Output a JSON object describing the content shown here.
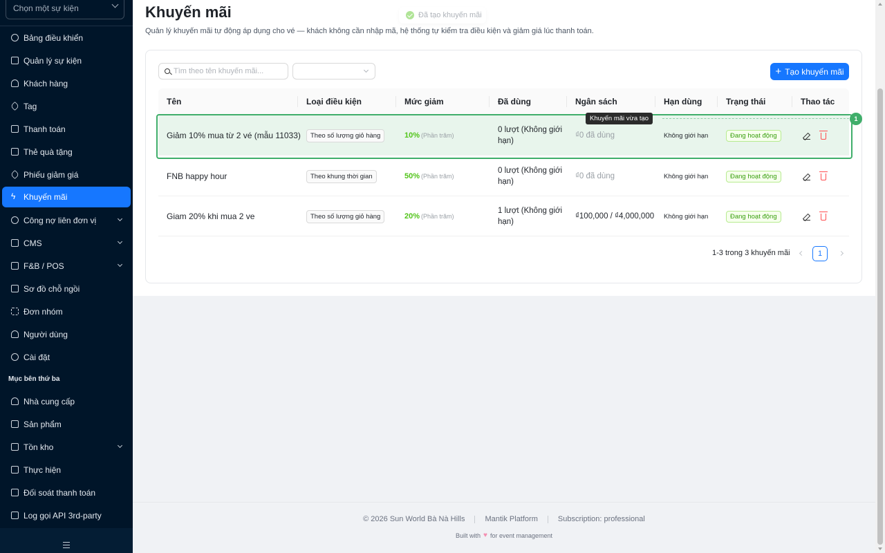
{
  "sidebar": {
    "event_select_placeholder": "Chọn một sự kiện",
    "items": [
      {
        "label": "Bảng điều khiển"
      },
      {
        "label": "Quản lý sự kiện"
      },
      {
        "label": "Khách hàng"
      },
      {
        "label": "Tag"
      },
      {
        "label": "Thanh toán"
      },
      {
        "label": "Thẻ quà tặng"
      },
      {
        "label": "Phiếu giảm giá"
      },
      {
        "label": "Khuyến mãi"
      },
      {
        "label": "Công nợ liên đơn vị"
      },
      {
        "label": "CMS"
      },
      {
        "label": "F&B / POS"
      },
      {
        "label": "Sơ đồ chỗ ngồi"
      },
      {
        "label": "Đơn nhóm"
      },
      {
        "label": "Người dùng"
      },
      {
        "label": "Cài đặt"
      }
    ],
    "group_title": "Mục bên thứ ba",
    "group_items": [
      {
        "label": "Nhà cung cấp"
      },
      {
        "label": "Sản phẩm"
      },
      {
        "label": "Tồn kho"
      },
      {
        "label": "Thực hiện"
      },
      {
        "label": "Đối soát thanh toán"
      },
      {
        "label": "Log gọi API 3rd-party"
      }
    ]
  },
  "page": {
    "title": "Khuyến mãi",
    "description": "Quản lý khuyến mãi tự động áp dụng cho vé — khách không cần nhập mã, hệ thống tự kiểm tra điều kiện và giảm giá lúc thanh toán.",
    "toast": "Đã tạo khuyến mãi"
  },
  "toolbar": {
    "search_placeholder": "Tìm theo tên khuyến mãi...",
    "add_label": "Tạo khuyến mãi"
  },
  "table": {
    "headers": [
      "Tên",
      "Loại điều kiện",
      "Mức giảm",
      "Đã dùng",
      "Ngân sách",
      "Hạn dùng",
      "Trạng thái",
      "Thao tác"
    ],
    "rows": [
      {
        "name": "Giảm 10% mua từ 2 vé (mẫu 11033)",
        "condition": "Theo số lượng giỏ hàng",
        "discount": "10%",
        "discount_unit": "(Phần trăm)",
        "used": "0 lượt (Không giới hạn)",
        "budget": "₫0 đã dùng",
        "limit": "Không giới hạn",
        "status": "Đang hoạt động"
      },
      {
        "name": "FNB happy hour",
        "condition": "Theo khung thời gian",
        "discount": "50%",
        "discount_unit": "(Phần trăm)",
        "used": "0 lượt (Không giới hạn)",
        "budget": "₫0 đã dùng",
        "limit": "Không giới hạn",
        "status": "Đang hoạt động"
      },
      {
        "name": "Giam 20% khi mua 2 ve",
        "condition": "Theo số lượng giỏ hàng",
        "discount": "20%",
        "discount_unit": "(Phần trăm)",
        "used": "1 lượt (Không giới hạn)",
        "budget": "₫100,000 / ₫4,000,000",
        "limit": "Không giới hạn",
        "status": "Đang hoạt động"
      }
    ],
    "highlight_label": "Khuyến mãi vừa tạo",
    "highlight_badge": "1"
  },
  "pagination": {
    "summary": "1-3 trong 3 khuyến mãi",
    "current_page": "1"
  },
  "footer": {
    "copyright": "© 2026 Sun World Bà Nà Hills",
    "platform": "Mantik Platform",
    "subscription": "Subscription: professional",
    "built_with": "Built with",
    "built_for": "for event management"
  },
  "colors": {
    "sidebar_bg": "#001529",
    "accent": "#1677ff",
    "success": "#52c41a",
    "highlight": "#3fae6a",
    "danger": "#ff4d4f"
  }
}
